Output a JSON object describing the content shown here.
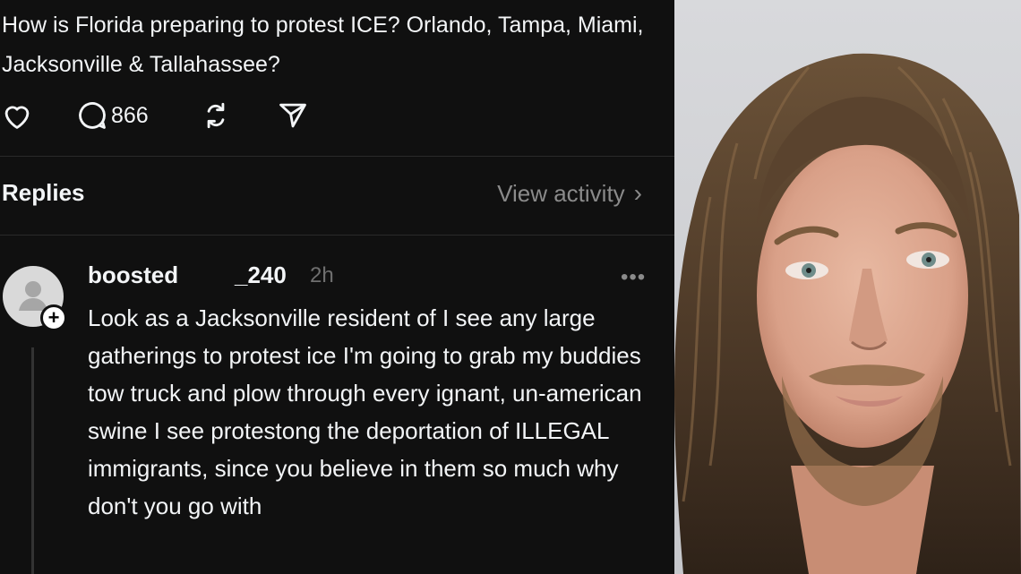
{
  "post": {
    "text": "How is Florida preparing to protest ICE? Orlando, Tampa, Miami, Jacksonville & Tallahassee?",
    "comment_count": "866"
  },
  "replies_section": {
    "title": "Replies",
    "view_activity": "View activity"
  },
  "reply": {
    "username": "boosted",
    "handle_suffix": "_240",
    "time": "2h",
    "text": "Look as a Jacksonville resident of I see any large gatherings to protest ice I'm going to grab my buddies tow truck and plow through every ignant, un-american swine I see protestong the deportation of ILLEGAL immigrants, since you believe in them so much why don't you go with",
    "more": "•••"
  },
  "icons": {
    "like": "heart-icon",
    "comment": "comment-bubble-icon",
    "repost": "repost-icon",
    "share": "send-icon",
    "chevron": "chevron-right-icon",
    "avatar": "default-avatar-icon",
    "follow": "plus-icon"
  },
  "colors": {
    "background": "#101010",
    "text": "#f3f5f7",
    "secondary_text": "#8a8a8a"
  }
}
